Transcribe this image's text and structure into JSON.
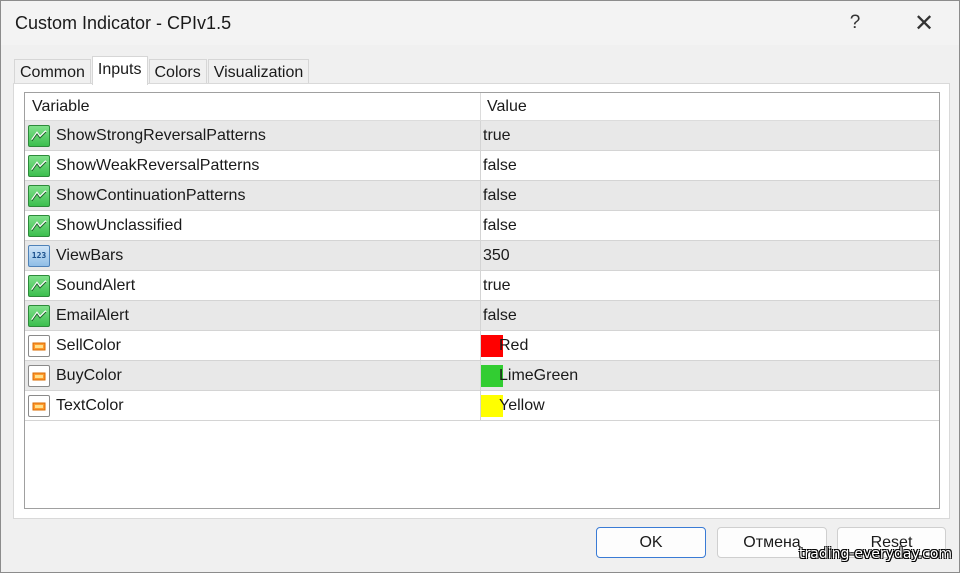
{
  "window": {
    "title": "Custom Indicator - CPIv1.5",
    "help": "?",
    "close": "✕"
  },
  "tabs": [
    {
      "label": "Common",
      "active": false
    },
    {
      "label": "Inputs",
      "active": true
    },
    {
      "label": "Colors",
      "active": false
    },
    {
      "label": "Visualization",
      "active": false
    }
  ],
  "grid": {
    "headers": {
      "variable": "Variable",
      "value": "Value"
    },
    "rows": [
      {
        "icon": "bool-icon",
        "name": "ShowStrongReversalPatterns",
        "value": "true"
      },
      {
        "icon": "bool-icon",
        "name": "ShowWeakReversalPatterns",
        "value": "false"
      },
      {
        "icon": "bool-icon",
        "name": "ShowContinuationPatterns",
        "value": "false"
      },
      {
        "icon": "bool-icon",
        "name": "ShowUnclassified",
        "value": "false"
      },
      {
        "icon": "number-icon",
        "name": "ViewBars",
        "value": "350",
        "icon_text": "123"
      },
      {
        "icon": "bool-icon",
        "name": "SoundAlert",
        "value": "true"
      },
      {
        "icon": "bool-icon",
        "name": "EmailAlert",
        "value": "false"
      },
      {
        "icon": "color-icon",
        "name": "SellColor",
        "value": "Red",
        "swatch": "#ff0000"
      },
      {
        "icon": "color-icon",
        "name": "BuyColor",
        "value": "LimeGreen",
        "swatch": "#32cd32"
      },
      {
        "icon": "color-icon",
        "name": "TextColor",
        "value": "Yellow",
        "swatch": "#ffff00"
      }
    ]
  },
  "buttons": {
    "ok": "OK",
    "cancel": "Отмена",
    "reset": "Reset"
  },
  "watermark": "trading-everyday.com",
  "colors": {
    "accent": "#3a7bd5",
    "row_alt": "#e8e8e8"
  }
}
